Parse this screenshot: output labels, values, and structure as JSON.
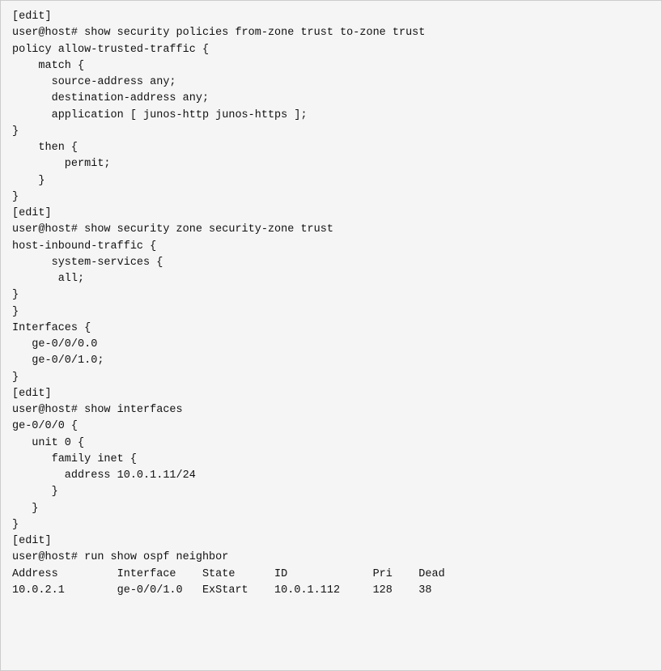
{
  "terminal": {
    "lines": [
      "[edit]",
      "user@host# show security policies from-zone trust to-zone trust",
      "policy allow-trusted-traffic {",
      "    match {",
      "      source-address any;",
      "      destination-address any;",
      "      application [ junos-http junos-https ];",
      "}",
      "    then {",
      "        permit;",
      "    }",
      "}",
      "[edit]",
      "user@host# show security zone security-zone trust",
      "host-inbound-traffic {",
      "      system-services {",
      "       all;",
      "}",
      "}",
      "Interfaces {",
      "   ge-0/0/0.0",
      "   ge-0/0/1.0;",
      "}",
      "[edit]",
      "user@host# show interfaces",
      "ge-0/0/0 {",
      "   unit 0 {",
      "      family inet {",
      "        address 10.0.1.11/24",
      "      }",
      "   }",
      "}",
      "[edit]",
      "user@host# run show ospf neighbor",
      "Address         Interface    State      ID             Pri    Dead",
      "10.0.2.1        ge-0/0/1.0   ExStart    10.0.1.112     128    38"
    ]
  }
}
